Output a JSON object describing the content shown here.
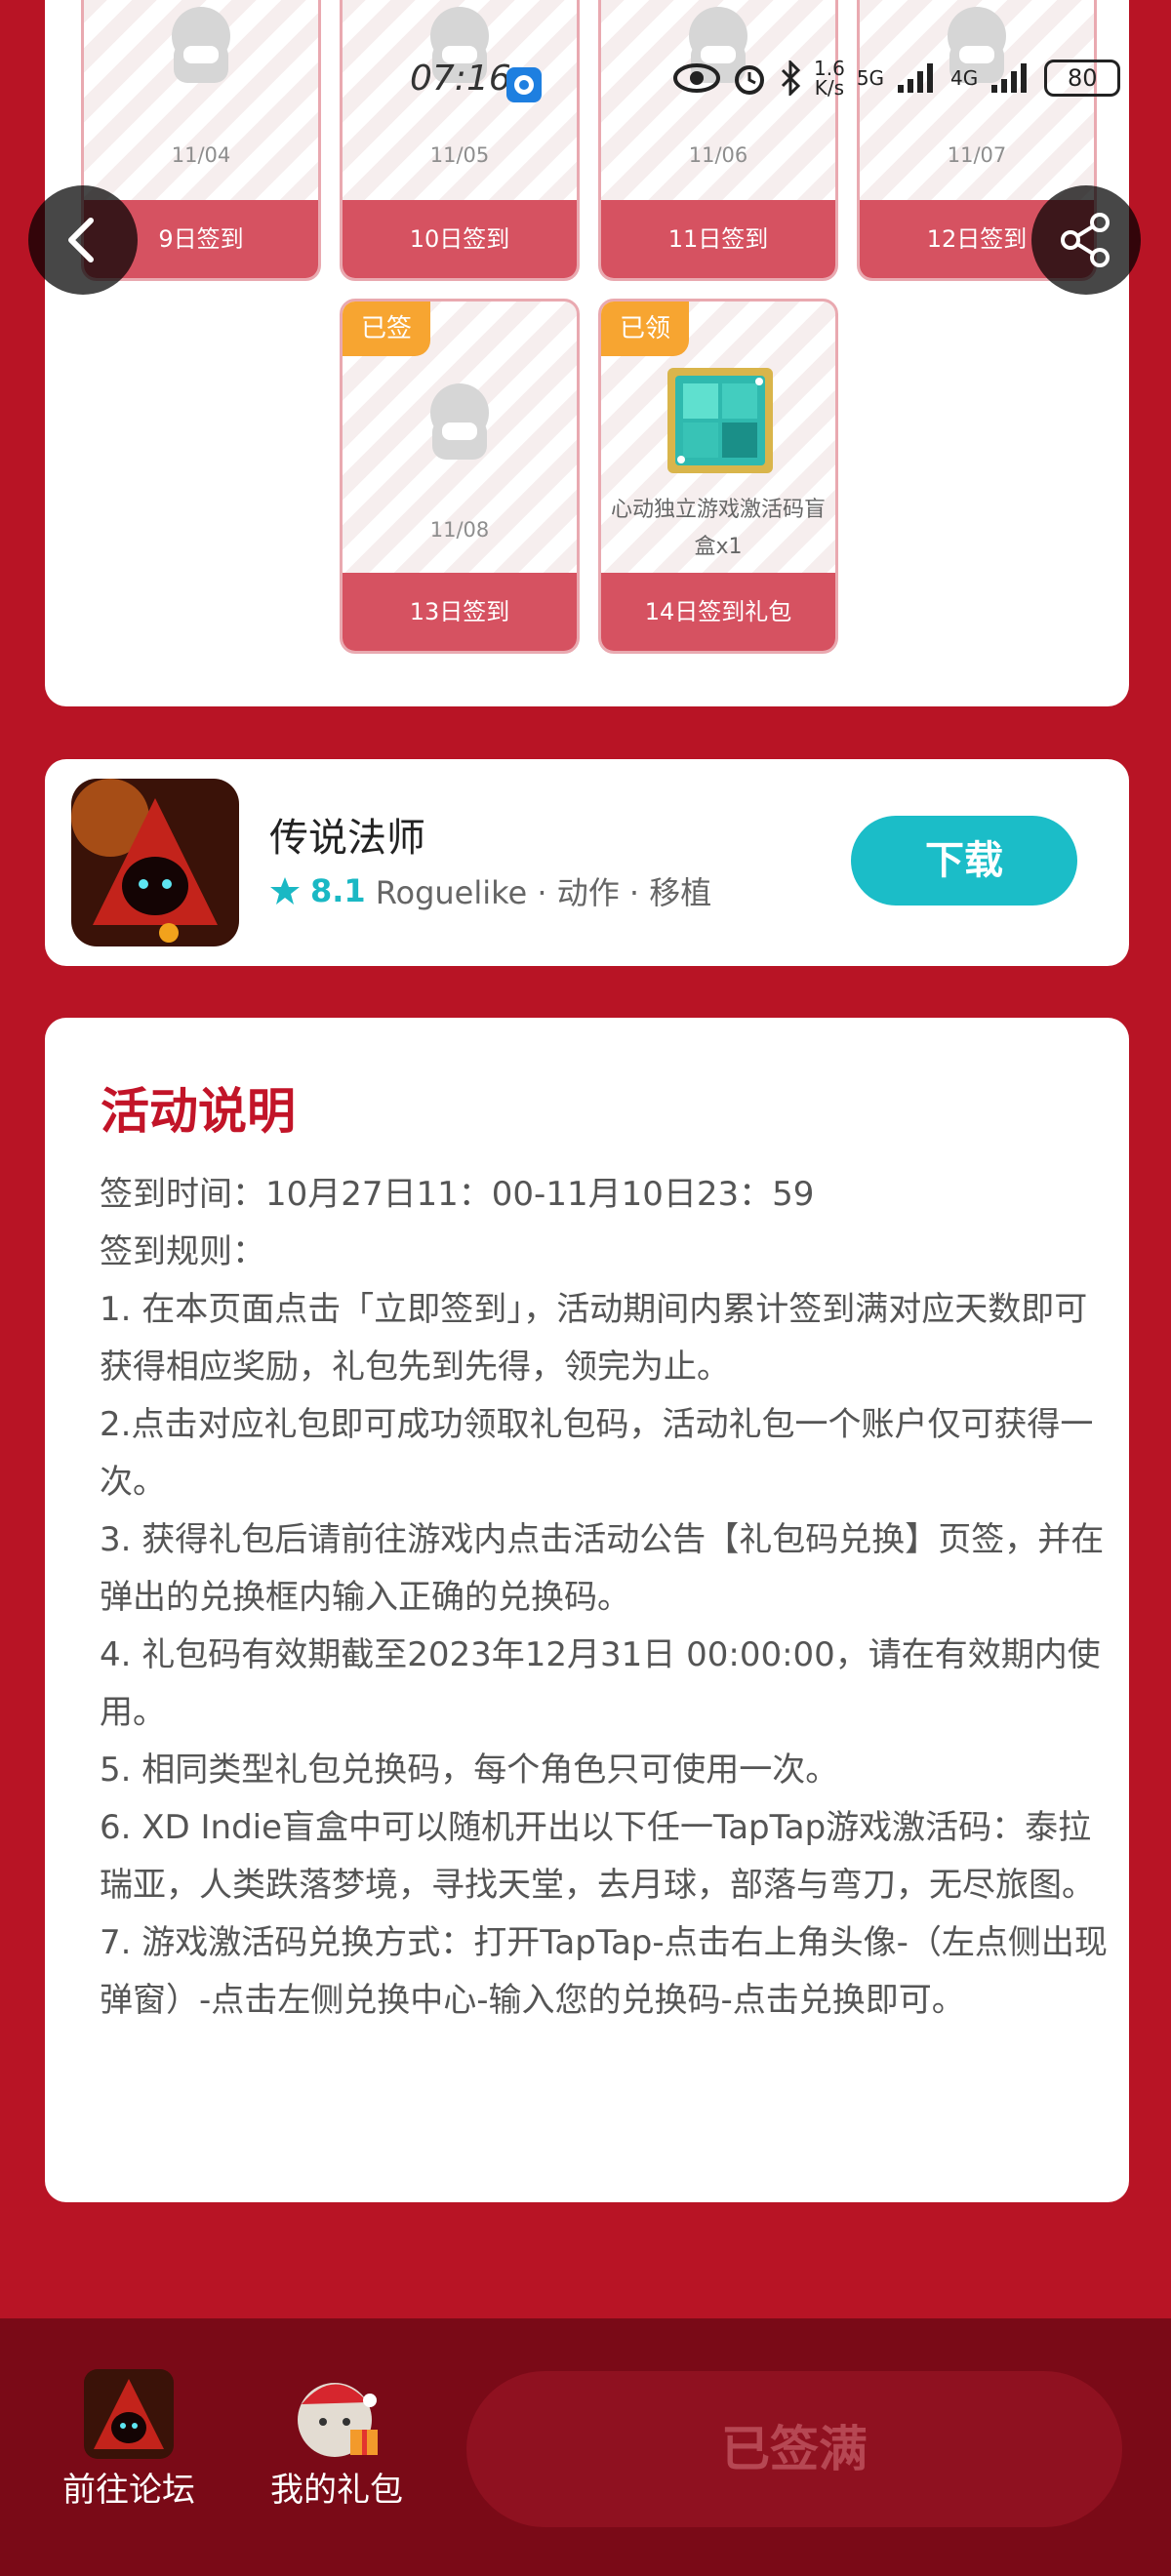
{
  "status_bar": {
    "time": "07:16",
    "net_speed_top": "1.6",
    "net_speed_bottom": "K/s",
    "net_5g": "5G",
    "net_4g": "4G",
    "battery": "80"
  },
  "checkin": {
    "days": [
      {
        "date": "11/04",
        "label": "9日签到"
      },
      {
        "date": "11/05",
        "label": "10日签到"
      },
      {
        "date": "11/06",
        "label": "11日签到"
      },
      {
        "date": "11/07",
        "label": "12日签到"
      },
      {
        "date": "11/08",
        "label": "13日签到",
        "badge": "已签"
      },
      {
        "gift_caption": "心动独立游戏激活码盲盒x1",
        "label": "14日签到礼包",
        "badge": "已领"
      }
    ]
  },
  "game": {
    "name": "传说法师",
    "rating": "8.1",
    "tags": "Roguelike · 动作 · 移植",
    "download_label": "下载"
  },
  "rules": {
    "title": "活动说明",
    "lines": [
      "签到时间：10月27日11：00-11月10日23：59",
      "签到规则：",
      "1. 在本页面点击「立即签到」，活动期间内累计签到满对应天数即可获得相应奖励，礼包先到先得，领完为止。",
      "2.点击对应礼包即可成功领取礼包码，活动礼包一个账户仅可获得一次。",
      "3. 获得礼包后请前往游戏内点击活动公告【礼包码兑换】页签，并在弹出的兑换框内输入正确的兑换码。",
      "4. 礼包码有效期截至2023年12月31日 00:00:00，请在有效期内使用。",
      "5. 相同类型礼包兑换码，每个角色只可使用一次。",
      "6. XD Indie盲盒中可以随机开出以下任一TapTap游戏激活码：泰拉瑞亚，人类跌落梦境，寻找天堂，去月球，部落与弯刀，无尽旅图。",
      "7. 游戏激活码兑换方式：打开TapTap-点击右上角头像-（左点侧出现弹窗）-点击左侧兑换中心-输入您的兑换码-点击兑换即可。"
    ]
  },
  "bottom": {
    "forum_label": "前往论坛",
    "gift_label": "我的礼包",
    "signed_full_label": "已签满"
  },
  "colors": {
    "page_bg": "#b81425",
    "accent_red": "#c21428",
    "teal": "#1bbdc8",
    "badge_orange": "#f7a531"
  }
}
